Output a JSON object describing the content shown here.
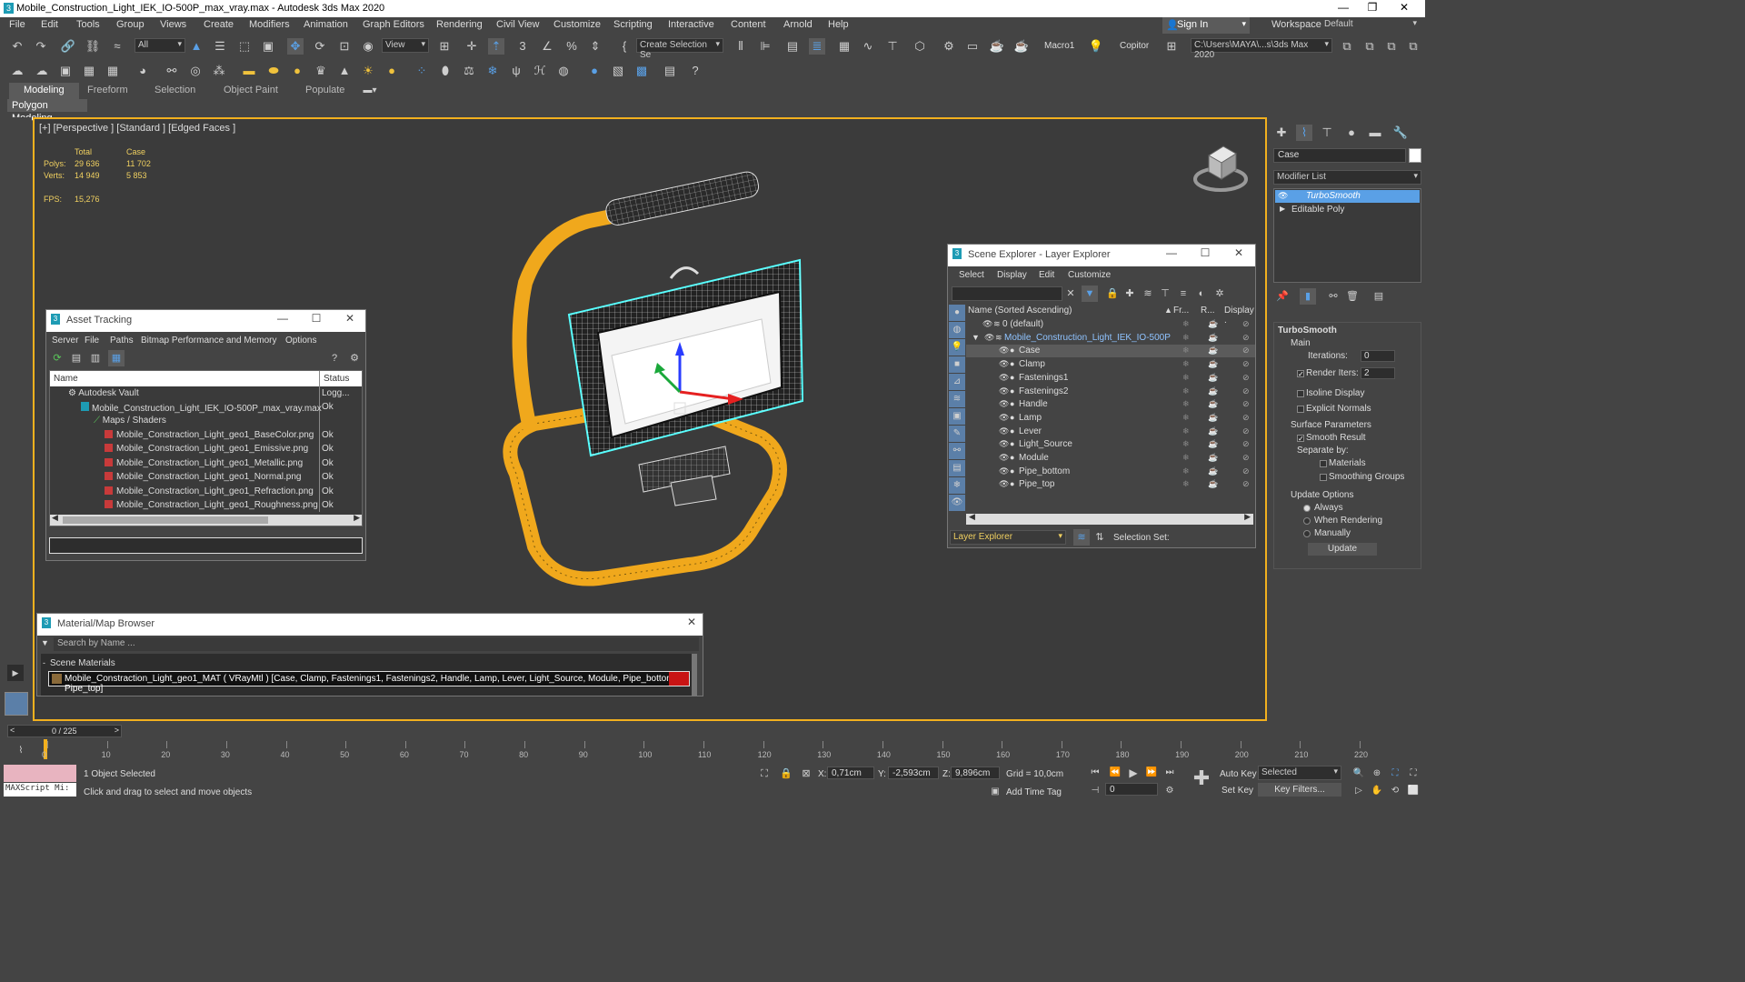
{
  "window": {
    "title": "Mobile_Construction_Light_IEK_IO-500P_max_vray.max - Autodesk 3ds Max 2020"
  },
  "menu": [
    "File",
    "Edit",
    "Tools",
    "Group",
    "Views",
    "Create",
    "Modifiers",
    "Animation",
    "Graph Editors",
    "Rendering",
    "Civil View",
    "Customize",
    "Scripting",
    "Interactive",
    "Content",
    "Arnold",
    "Help"
  ],
  "signin": {
    "label": "Sign In"
  },
  "workspaces": {
    "label": "Workspaces:",
    "value": "Default"
  },
  "toolbar": {
    "filter_value": "All",
    "view_value": "View",
    "selection_set_placeholder": "Create Selection Se",
    "macro_label": "Macro1",
    "copitor_label": "Copitor",
    "path_value": "C:\\Users\\MAYA\\...s\\3ds Max 2020"
  },
  "ribbon": {
    "tabs": [
      "Modeling",
      "Freeform",
      "Selection",
      "Object Paint",
      "Populate"
    ],
    "active": "Modeling",
    "sub": "Polygon Modeling"
  },
  "viewport": {
    "label": "[+] [Perspective ] [Standard ] [Edged Faces ]",
    "stats": {
      "col_total": "Total",
      "col_case": "Case",
      "polys_label": "Polys:",
      "polys_total": "29 636",
      "polys_case": "11 702",
      "verts_label": "Verts:",
      "verts_total": "14 949",
      "verts_case": "5 853",
      "fps_label": "FPS:",
      "fps_value": "15,276"
    }
  },
  "asset_tracking": {
    "title": "Asset Tracking",
    "menu": [
      "Server",
      "File",
      "Paths",
      "Bitmap Performance and Memory",
      "Options"
    ],
    "columns": [
      "Name",
      "Status"
    ],
    "rows": [
      {
        "name": "Autodesk Vault",
        "status": "Logg..."
      },
      {
        "name": "Mobile_Construction_Light_IEK_IO-500P_max_vray.max",
        "status": "Ok"
      },
      {
        "name": "Maps / Shaders",
        "status": ""
      },
      {
        "name": "Mobile_Constraction_Light_geo1_BaseColor.png",
        "status": "Ok"
      },
      {
        "name": "Mobile_Constraction_Light_geo1_Emissive.png",
        "status": "Ok"
      },
      {
        "name": "Mobile_Constraction_Light_geo1_Metallic.png",
        "status": "Ok"
      },
      {
        "name": "Mobile_Constraction_Light_geo1_Normal.png",
        "status": "Ok"
      },
      {
        "name": "Mobile_Constraction_Light_geo1_Refraction.png",
        "status": "Ok"
      },
      {
        "name": "Mobile_Constraction_Light_geo1_Roughness.png",
        "status": "Ok"
      }
    ]
  },
  "scene_explorer": {
    "title": "Scene Explorer - Layer Explorer",
    "menu": [
      "Select",
      "Display",
      "Edit",
      "Customize"
    ],
    "columns": {
      "name": "Name (Sorted Ascending)",
      "fr": "Fr...",
      "r": "R...",
      "display": "Display ."
    },
    "layers": [
      "0 (default)",
      "Mobile_Construction_Light_IEK_IO-500P"
    ],
    "objects": [
      "Case",
      "Clamp",
      "Fastenings1",
      "Fastenings2",
      "Handle",
      "Lamp",
      "Lever",
      "Light_Source",
      "Module",
      "Pipe_bottom",
      "Pipe_top"
    ],
    "footer_dropdown": "Layer Explorer",
    "selection_set_label": "Selection Set:"
  },
  "material_browser": {
    "title": "Material/Map Browser",
    "search_placeholder": "Search by Name ...",
    "section": "Scene Materials",
    "material": "Mobile_Constraction_Light_geo1_MAT ( VRayMtl ) [Case, Clamp, Fastenings1, Fastenings2, Handle, Lamp, Lever, Light_Source, Module, Pipe_bottom, Pipe_top]"
  },
  "command_panel": {
    "object_name": "Case",
    "modifier_list": "Modifier List",
    "stack": [
      "TurboSmooth",
      "Editable Poly"
    ],
    "rollout_title": "TurboSmooth",
    "main_label": "Main",
    "iterations_label": "Iterations:",
    "iterations_value": "0",
    "render_iters_label": "Render Iters:",
    "render_iters_value": "2",
    "isoline_label": "Isoline Display",
    "explicit_label": "Explicit Normals",
    "surface_label": "Surface Parameters",
    "smooth_result_label": "Smooth Result",
    "separate_label": "Separate by:",
    "materials_label": "Materials",
    "smoothing_label": "Smoothing Groups",
    "update_options_label": "Update Options",
    "always_label": "Always",
    "when_rendering_label": "When Rendering",
    "manually_label": "Manually",
    "update_button": "Update"
  },
  "timeline": {
    "frame_display": "0 / 225",
    "ticks": [
      "0",
      "10",
      "20",
      "30",
      "40",
      "50",
      "60",
      "70",
      "80",
      "90",
      "100",
      "110",
      "120",
      "130",
      "140",
      "150",
      "160",
      "170",
      "180",
      "190",
      "200",
      "210",
      "220"
    ]
  },
  "status": {
    "selected": "1 Object Selected",
    "prompt": "Click and drag to select and move objects",
    "maxscript": "MAXScript Mi:",
    "x_label": "X:",
    "x_value": "0,71cm",
    "y_label": "Y:",
    "y_value": "-2,593cm",
    "z_label": "Z:",
    "z_value": "9,896cm",
    "grid": "Grid = 10,0cm",
    "add_time_tag": "Add Time Tag",
    "auto_key": "Auto Key",
    "set_key": "Set Key",
    "selected_dd": "Selected",
    "key_filters": "Key Filters...",
    "frame_value": "0"
  },
  "colors": {
    "accent": "#f2b01e",
    "selection": "#5aa0e6",
    "pipe": "#f0a81c"
  }
}
